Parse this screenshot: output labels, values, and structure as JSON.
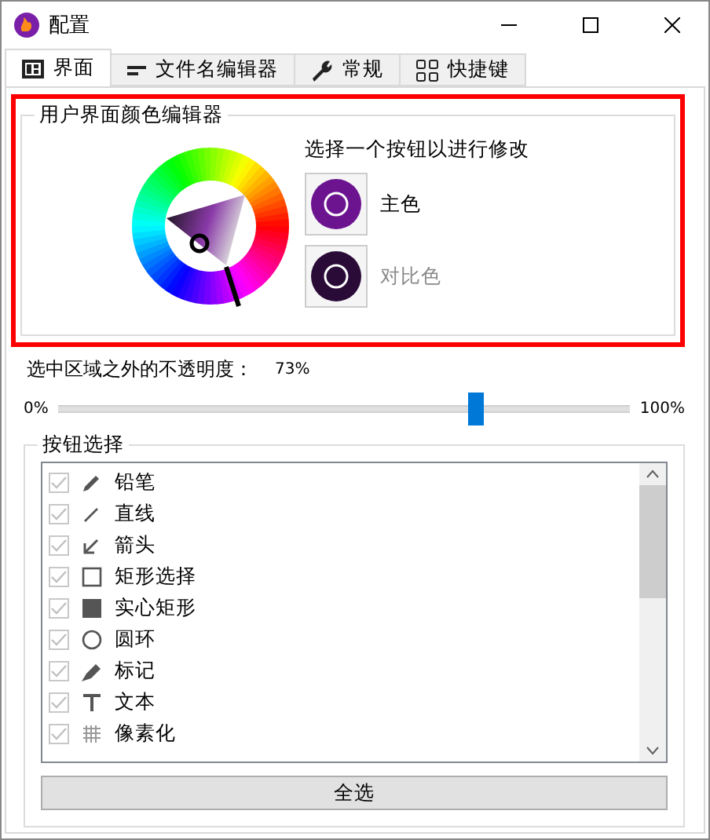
{
  "window": {
    "title": "配置"
  },
  "tabs": [
    {
      "label": "界面",
      "selected": true
    },
    {
      "label": "文件名编辑器",
      "selected": false
    },
    {
      "label": "常规",
      "selected": false
    },
    {
      "label": "快捷键",
      "selected": false
    }
  ],
  "color_editor": {
    "title": "用户界面颜色编辑器",
    "hint": "选择一个按钮以进行修改",
    "highlighted": true,
    "color_buttons": [
      {
        "label": "主色",
        "color": "#6c1490",
        "selected": true
      },
      {
        "label": "对比色",
        "color": "#2a0b38",
        "selected": false
      }
    ]
  },
  "opacity": {
    "label": "选中区域之外的不透明度：",
    "reading": "73%",
    "min_label": "0%",
    "max_label": "100%",
    "level": 0.73
  },
  "button_selection": {
    "title": "按钮选择",
    "items": [
      {
        "label": "铅笔",
        "checked": true
      },
      {
        "label": "直线",
        "checked": true
      },
      {
        "label": "箭头",
        "checked": true
      },
      {
        "label": "矩形选择",
        "checked": true
      },
      {
        "label": "实心矩形",
        "checked": true
      },
      {
        "label": "圆环",
        "checked": true
      },
      {
        "label": "标记",
        "checked": true
      },
      {
        "label": "文本",
        "checked": true
      },
      {
        "label": "像素化",
        "checked": true
      }
    ],
    "select_all": "全选"
  }
}
